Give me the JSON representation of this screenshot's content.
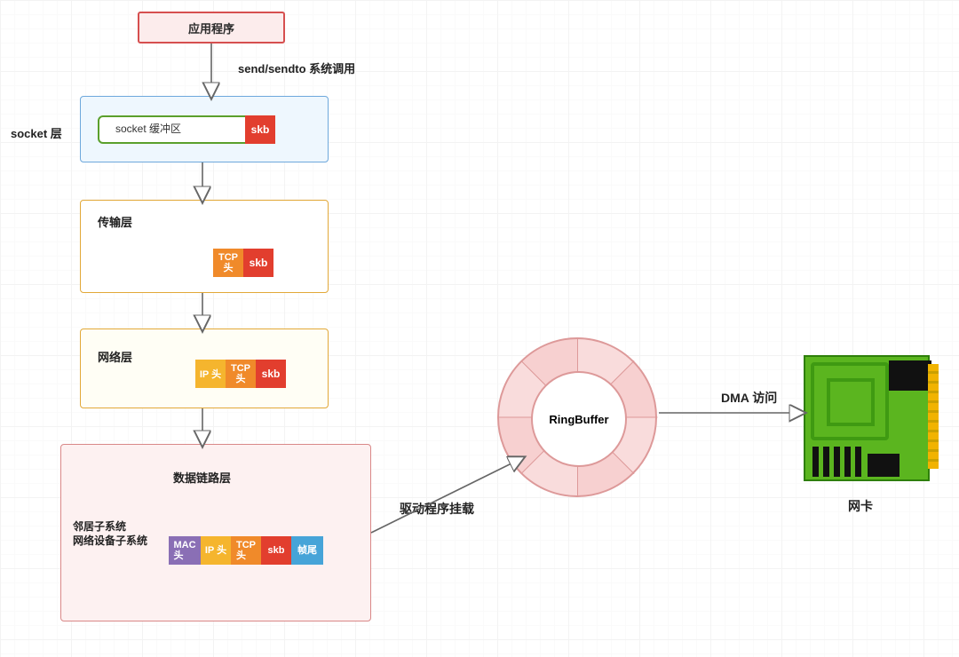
{
  "socket_layer_label": "socket 层",
  "app_box": "应用程序",
  "send_call_label": "send/sendto 系统调用",
  "socket_buffer_label": "socket 缓冲区",
  "skb": "skb",
  "transport_title": "传输层",
  "tcp_header": "TCP\n头",
  "network_title": "网络层",
  "ip_header": "IP 头",
  "datalink_title": "数据链路层",
  "datalink_sub": "邻居子系统\n网络设备子系统",
  "mac_header": "MAC\n头",
  "frame_tail": "帧尾",
  "driver_label": "驱动程序挂载",
  "ringbuffer": "RingBuffer",
  "dma_label": "DMA 访问",
  "nic_label": "网卡"
}
